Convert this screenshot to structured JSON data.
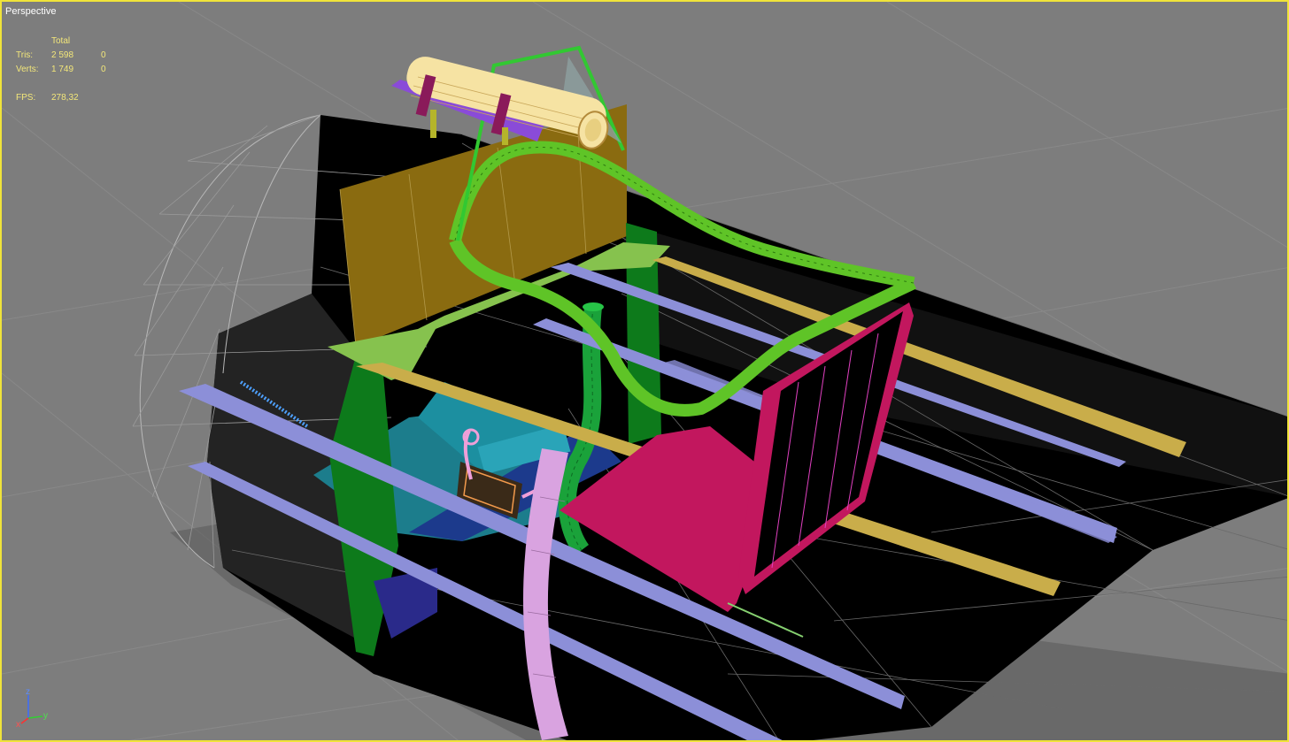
{
  "viewport": {
    "label": "Perspective",
    "border_color": "#f0e33a"
  },
  "stats": {
    "header": "Total",
    "tris_label": "Tris:",
    "tris_total": "2 598",
    "tris_sel": "0",
    "verts_label": "Verts:",
    "verts_total": "1 749",
    "verts_sel": "0",
    "fps_label": "FPS:",
    "fps_value": "278,32",
    "text_color": "#f3e77a"
  },
  "axis_tripod": {
    "z": "z",
    "x": "x",
    "y": "y"
  },
  "colors": {
    "background": "#7d7d7d",
    "hull": "#000000",
    "green_frame": "#0d7a1b",
    "roll_cage": "#5fc427",
    "bulkhead": "#8a6b10",
    "seat": "#c2175e",
    "rails_blue": "#8c8fd8",
    "rails_yellow": "#c9ad4a",
    "tank": "#f6e3a3"
  }
}
